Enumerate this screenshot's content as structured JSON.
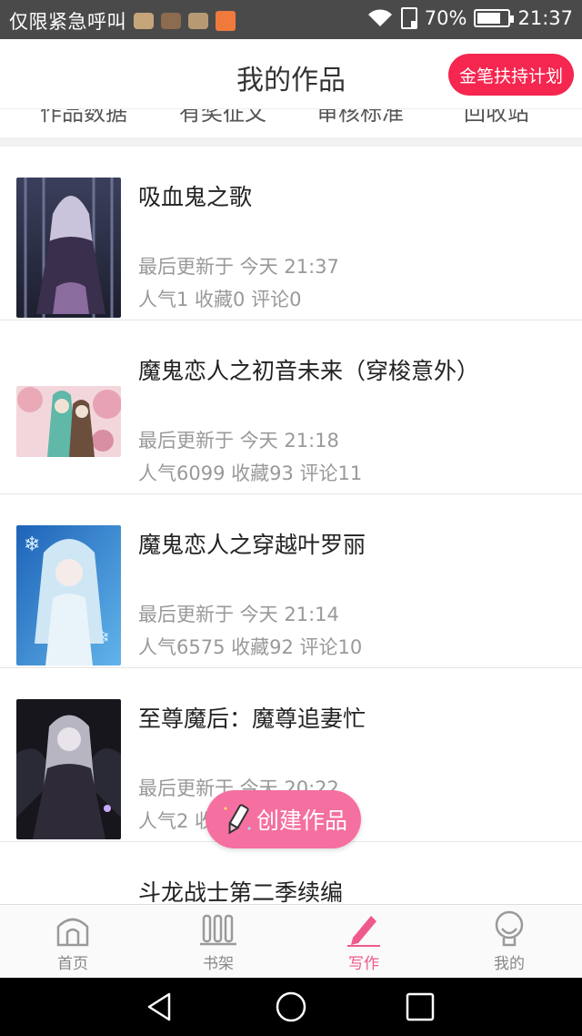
{
  "status_bar": {
    "carrier_text": "仅限紧急呼叫",
    "battery_pct": "70%",
    "time": "21:37",
    "notification_icons": [
      "tea-app-icon",
      "tea-app-icon",
      "tea-app-icon",
      "gallery-icon"
    ]
  },
  "header": {
    "title": "我的作品",
    "plan_button": "金笔扶持计划"
  },
  "tabs": [
    "作品数据",
    "有奖征文",
    "审核标准",
    "回收站"
  ],
  "works": [
    {
      "title": "吸血鬼之歌",
      "updated": "最后更新于 今天 21:37",
      "stats": "人气1 收藏0 评论0"
    },
    {
      "title": "魔鬼恋人之初音未来（穿梭意外）",
      "updated": "最后更新于 今天 21:18",
      "stats": "人气6099 收藏93 评论11"
    },
    {
      "title": "魔鬼恋人之穿越叶罗丽",
      "updated": "最后更新于 今天 21:14",
      "stats": "人气6575 收藏92 评论10"
    },
    {
      "title": "至尊魔后：魔尊追妻忙",
      "updated": "最后更新于 今天 20:22",
      "stats": "人气2 收藏0 评论0"
    },
    {
      "title": "斗龙战士第二季续编",
      "updated": "",
      "stats": ""
    }
  ],
  "create_button": "创建作品",
  "bottom_nav": [
    {
      "label": "首页",
      "icon": "home-icon",
      "active": false
    },
    {
      "label": "书架",
      "icon": "bookshelf-icon",
      "active": false
    },
    {
      "label": "写作",
      "icon": "pencil-icon",
      "active": true
    },
    {
      "label": "我的",
      "icon": "profile-icon",
      "active": false
    }
  ],
  "colors": {
    "accent": "#f05a8a",
    "plan_button": "#f5264f",
    "create_button": "#f56fa0",
    "status_bar": "#4a4a4a"
  }
}
